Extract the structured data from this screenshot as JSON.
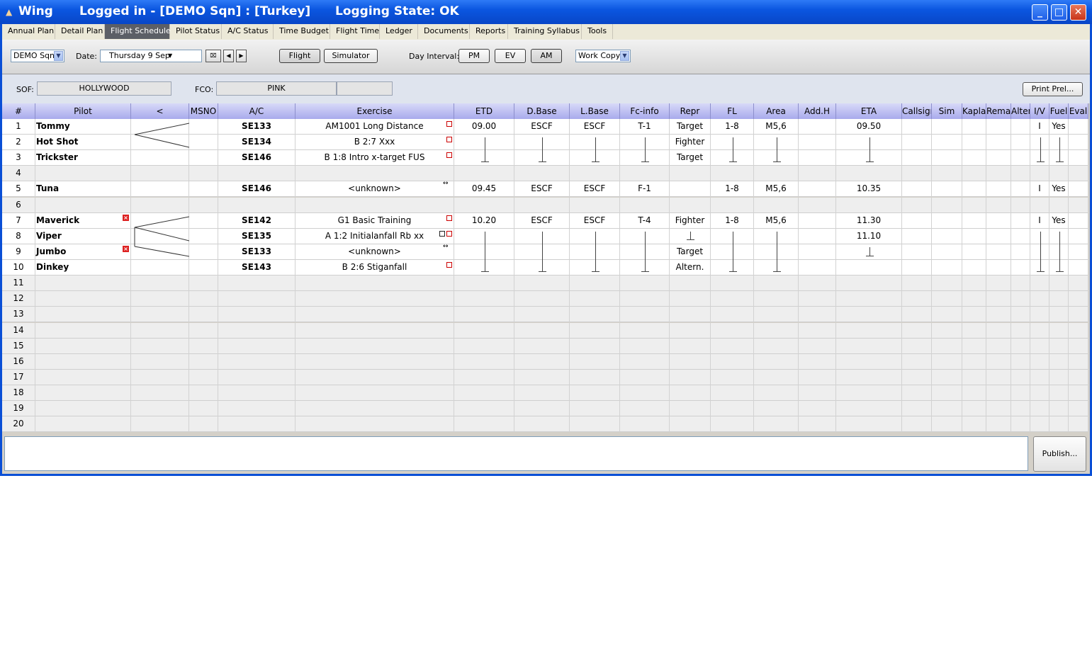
{
  "window": {
    "app_name": "Wing",
    "login": "Logged in - [DEMO Sqn] : [Turkey]",
    "logging_state": "Logging State: OK"
  },
  "tabs": [
    "Annual Plan",
    "Detail Plan",
    "Flight Schedule",
    "Pilot Status",
    "A/C Status",
    "Time Budget",
    "Flight Time",
    "Ledger",
    "Documents",
    "Reports",
    "Training Syllabus",
    "Tools"
  ],
  "active_tab": "Flight Schedule",
  "toolbar": {
    "squadron": "DEMO Sqn",
    "date_label": "Date:",
    "date_value": "Thursday 9 Sep",
    "flight_btn": "Flight",
    "simulator_btn": "Simulator",
    "day_interval_label": "Day Interval:",
    "pm_btn": "PM",
    "ev_btn": "EV",
    "am_btn": "AM",
    "copy_select": "Work Copy"
  },
  "duty": {
    "sof_label": "SOF:",
    "sof_value": "HOLLYWOOD",
    "fco_label": "FCO:",
    "fco_value": "PINK",
    "print_btn": "Print Prel..."
  },
  "columns": [
    "#",
    "Pilot",
    "<",
    "MSNO",
    "A/C",
    "Exercise",
    "ETD",
    "D.Base",
    "L.Base",
    "Fc-info",
    "Repr",
    "FL",
    "Area",
    "Add.H",
    "ETA",
    "Callsign",
    "Sim",
    "Kaplan",
    "Remarks",
    "Alter",
    "I/V",
    "Fuel",
    "Eval"
  ],
  "rows": [
    {
      "n": "1",
      "pilot": "Tommy",
      "ac": "SE133",
      "exercise": "AM1001 Long Distance",
      "etd": "09.00",
      "dbase": "ESCF",
      "lbase": "ESCF",
      "fc": "T-1",
      "repr": "Target",
      "fl": "1-8",
      "area": "M5,6",
      "eta": "09.50",
      "iv": "I",
      "fuel": "Yes"
    },
    {
      "n": "2",
      "pilot": "Hot Shot",
      "ac": "SE134",
      "exercise": "B 2:7 Xxx",
      "etd": "",
      "dbase": "",
      "lbase": "",
      "fc": "",
      "repr": "Fighter",
      "fl": "",
      "area": "",
      "eta": "",
      "iv": "",
      "fuel": ""
    },
    {
      "n": "3",
      "pilot": "Trickster",
      "ac": "SE146",
      "exercise": "B 1:8 Intro x-target FUS",
      "etd": "",
      "dbase": "",
      "lbase": "",
      "fc": "",
      "repr": "Target",
      "fl": "",
      "area": "",
      "eta": "",
      "iv": "",
      "fuel": ""
    },
    {
      "n": "4",
      "pilot": "",
      "ac": "",
      "exercise": "",
      "etd": "",
      "dbase": "",
      "lbase": "",
      "fc": "",
      "repr": "",
      "fl": "",
      "area": "",
      "eta": "",
      "iv": "",
      "fuel": ""
    },
    {
      "n": "5",
      "pilot": "Tuna",
      "ac": "SE146",
      "exercise": "<unknown>",
      "etd": "09.45",
      "dbase": "ESCF",
      "lbase": "ESCF",
      "fc": "F-1",
      "repr": "",
      "fl": "1-8",
      "area": "M5,6",
      "eta": "10.35",
      "iv": "I",
      "fuel": "Yes"
    },
    {
      "n": "6",
      "pilot": "",
      "ac": "",
      "exercise": "",
      "etd": "",
      "dbase": "",
      "lbase": "",
      "fc": "",
      "repr": "",
      "fl": "",
      "area": "",
      "eta": "",
      "iv": "",
      "fuel": ""
    },
    {
      "n": "7",
      "pilot": "Maverick",
      "ac": "SE142",
      "exercise": "G1 Basic Training",
      "etd": "10.20",
      "dbase": "ESCF",
      "lbase": "ESCF",
      "fc": "T-4",
      "repr": "Fighter",
      "fl": "1-8",
      "area": "M5,6",
      "eta": "11.30",
      "iv": "I",
      "fuel": "Yes"
    },
    {
      "n": "8",
      "pilot": "Viper",
      "ac": "SE135",
      "exercise": "A 1:2 Initialanfall Rb xx",
      "etd": "",
      "dbase": "",
      "lbase": "",
      "fc": "",
      "repr": "",
      "fl": "",
      "area": "",
      "eta": "11.10",
      "iv": "",
      "fuel": ""
    },
    {
      "n": "9",
      "pilot": "Jumbo",
      "ac": "SE133",
      "exercise": "<unknown>",
      "etd": "",
      "dbase": "",
      "lbase": "",
      "fc": "",
      "repr": "Target",
      "fl": "",
      "area": "",
      "eta": "",
      "iv": "",
      "fuel": ""
    },
    {
      "n": "10",
      "pilot": "Dinkey",
      "ac": "SE143",
      "exercise": "B 2:6 Stiganfall",
      "etd": "",
      "dbase": "",
      "lbase": "",
      "fc": "",
      "repr": "Altern.",
      "fl": "",
      "area": "",
      "eta": "",
      "iv": "",
      "fuel": ""
    },
    {
      "n": "11"
    },
    {
      "n": "12"
    },
    {
      "n": "13"
    },
    {
      "n": "14"
    },
    {
      "n": "15"
    },
    {
      "n": "16"
    },
    {
      "n": "17"
    },
    {
      "n": "18"
    },
    {
      "n": "19"
    },
    {
      "n": "20"
    }
  ],
  "publish_btn": "Publish..."
}
